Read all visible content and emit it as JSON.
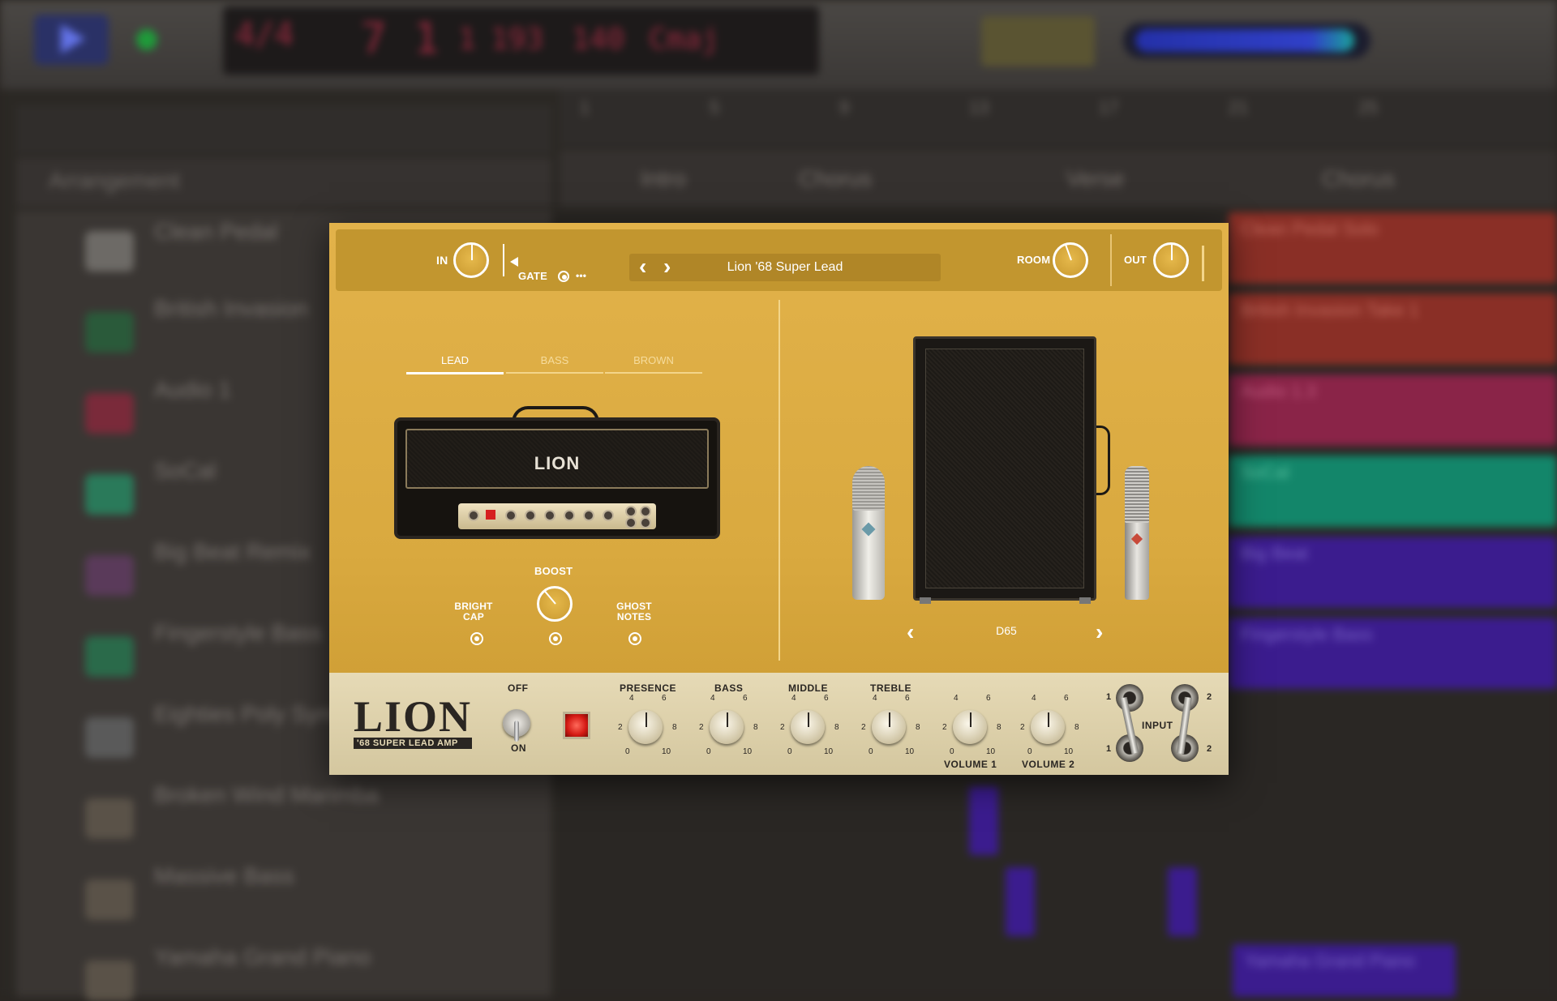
{
  "daw": {
    "lcd": {
      "sig": "4/4",
      "bar": "7",
      "beat": "1",
      "div": "1",
      "tick": "193",
      "tempo": "140",
      "key": "Cmaj"
    },
    "arrangement_title": "Arrangement",
    "markers": [
      "Intro",
      "Chorus",
      "Verse",
      "Chorus"
    ],
    "ruler": [
      "1",
      "5",
      "9",
      "13",
      "17",
      "21",
      "25"
    ],
    "tracks": [
      {
        "name": "Clean Pedal",
        "color": "#6d6a66"
      },
      {
        "name": "British Invasion",
        "color": "#2a5a3a"
      },
      {
        "name": "Audio 1",
        "color": "#7a2a3a"
      },
      {
        "name": "SoCal",
        "color": "#2a7a5a"
      },
      {
        "name": "Big Beat Remix",
        "color": "#5a3a5a"
      },
      {
        "name": "Fingerstyle Bass",
        "color": "#2a6a4a"
      },
      {
        "name": "Eighties Poly Synth",
        "color": "#5a5a5a"
      },
      {
        "name": "Broken Wind Marimba",
        "color": "#5a5248"
      },
      {
        "name": "Massive Bass",
        "color": "#5a5248"
      },
      {
        "name": "Yamaha Grand Piano",
        "color": "#5a5248"
      }
    ],
    "regions": [
      "Clean Pedal Solo",
      "British Invasion Take 1",
      "Audio 1.3",
      "SoCal",
      "Big Beat",
      "Fingerstyle Bass",
      "Yamaha Grand Piano"
    ]
  },
  "plugin": {
    "header": {
      "in_label": "IN",
      "gate_label": "GATE",
      "more_label": "•••",
      "preset_name": "Lion '68 Super Lead",
      "prev_label": "‹",
      "next_label": "›",
      "room_label": "ROOM",
      "out_label": "OUT"
    },
    "amp_tabs": [
      {
        "label": "LEAD",
        "active": true
      },
      {
        "label": "BASS",
        "active": false
      },
      {
        "label": "BROWN",
        "active": false
      }
    ],
    "amp_logo": "LION",
    "switches": {
      "bright_cap": "BRIGHT CAP",
      "boost": "BOOST",
      "ghost_notes": "GHOST NOTES"
    },
    "cabinet": {
      "name": "D65",
      "prev": "‹",
      "next": "›"
    },
    "panel": {
      "logo": "LION",
      "logo_sub": "'68 SUPER LEAD AMP",
      "off_label": "OFF",
      "on_label": "ON",
      "knobs": [
        {
          "label": "PRESENCE",
          "value": 5
        },
        {
          "label": "BASS",
          "value": 5
        },
        {
          "label": "MIDDLE",
          "value": 5
        },
        {
          "label": "TREBLE",
          "value": 5
        },
        {
          "label": "VOLUME 1",
          "value": 5
        },
        {
          "label": "VOLUME 2",
          "value": 5
        }
      ],
      "scale": {
        "n0": "0",
        "n2": "2",
        "n4": "4",
        "n6": "6",
        "n8": "8",
        "n10": "10"
      },
      "input_label": "INPUT",
      "jack1": "1",
      "jack2": "2"
    }
  }
}
